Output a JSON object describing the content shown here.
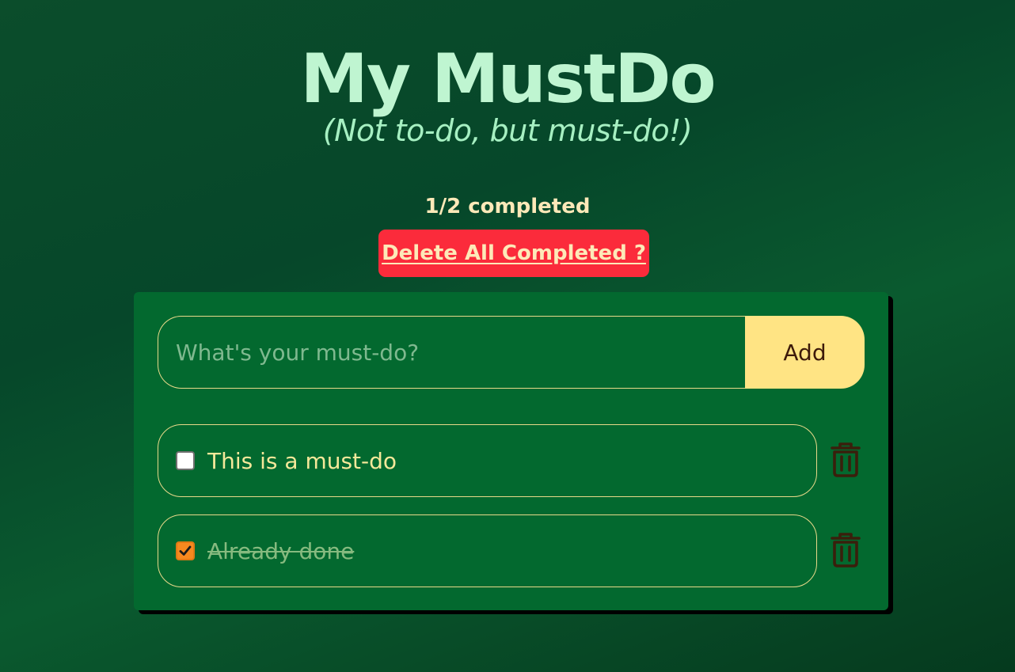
{
  "header": {
    "title": "My MustDo",
    "subtitle": "(Not to-do, but must-do!)"
  },
  "summary": {
    "status_text": "1/2 completed",
    "completed": 1,
    "total": 2,
    "delete_all_label": "Delete All Completed ?"
  },
  "form": {
    "placeholder": "What's your must-do?",
    "value": "",
    "add_label": "Add"
  },
  "todos": [
    {
      "text": "This is a must-do",
      "done": false
    },
    {
      "text": "Already done",
      "done": true
    }
  ],
  "icons": {
    "delete": "trash-icon",
    "check": "checkmark-icon"
  },
  "colors": {
    "background": "#06472a",
    "card": "#03692f",
    "title": "#bff5d1",
    "accent_text": "#fde9b8",
    "danger": "#fb2b3b",
    "add_button": "#ffe484",
    "checkbox_checked": "#f6891f",
    "trash_icon": "#3a1f0c"
  }
}
